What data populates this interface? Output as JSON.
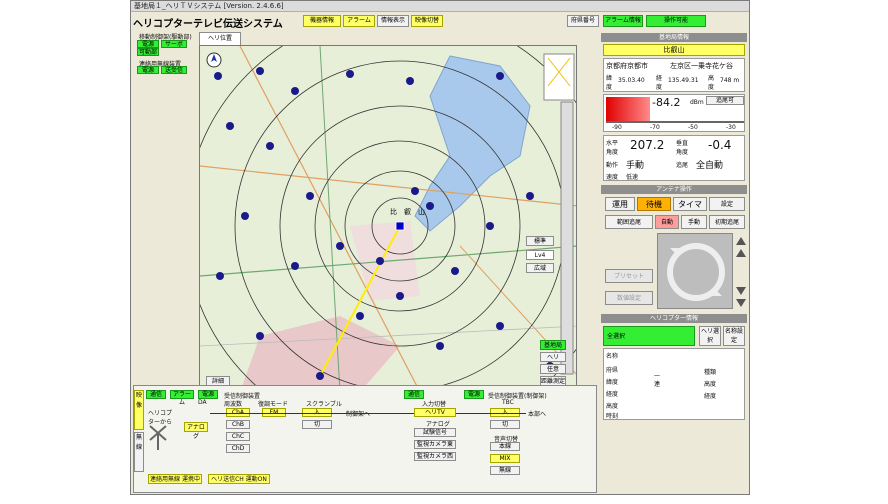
{
  "window": {
    "title": "基地局１_ヘリＴＶシステム [Version. 2.4.6.6]",
    "app_title": "ヘリコプターテレビ伝送システム"
  },
  "toolbar": {
    "equipment_info": "機器情報",
    "alarm": "アラーム",
    "info_display": "情報表示",
    "video_switch": "映像切替",
    "station_number": "府県番号",
    "alarm_info": "アラーム情報",
    "operation_enabled": "操作可能"
  },
  "left_panel": {
    "drive_control_label": "移動制御架(駆動部)",
    "power": "電源",
    "servo": "サーボ",
    "fixed_unit": "可動部",
    "comm_device_label": "連絡用無線装置",
    "power2": "電源",
    "tx_rx": "送受信"
  },
  "map": {
    "tab": "ヘリ位置",
    "label_hiei": "比　叡　山",
    "buttons": {
      "standard": "標準",
      "level": "Lv4",
      "wide": "広域",
      "base_station": "基地局",
      "heli": "ヘリ",
      "arbitrary": "任意",
      "distance": "距離測定",
      "detail": "詳細"
    }
  },
  "station_info": {
    "header": "基地局情報",
    "name": "比叡山",
    "address_pref": "京都府京都市",
    "address_ward": "左京区一乗寺花ケ谷",
    "lat_label": "緯度",
    "lat": "35.03.40",
    "lon_label": "経度",
    "lon": "135.49.31",
    "alt_label": "高度",
    "alt": "748 m",
    "signal": "-84.2",
    "signal_unit": "dBm",
    "tracking": "追尾可",
    "scale": [
      "-90",
      "-70",
      "-50",
      "-30"
    ],
    "signal_level": 0.18,
    "h_label": "水平角度",
    "h_value": "207.2",
    "v_label": "垂直角度",
    "v_value": "-0.4",
    "motion_label": "動作",
    "motion_value": "手動",
    "track_label": "追尾",
    "track_value": "全自動",
    "speed_label": "速度",
    "speed_value": "低速"
  },
  "antenna": {
    "header": "アンテナ操作",
    "operate": "運用",
    "standby": "待機",
    "timer": "タイマ",
    "setting": "設定",
    "range_track": "範囲追尾",
    "auto": "自動",
    "manual": "手動",
    "initial_track": "初期追尾",
    "preset": "プリセット",
    "value_setting": "数値設定"
  },
  "heli_info": {
    "header": "ヘリコプター情報",
    "select_all": "全選択",
    "heli_select": "ヘリ選択",
    "name_select": "名称設定",
    "rows_left": [
      "名称",
      "府県",
      "緯度",
      "経度",
      "高度",
      "時刻"
    ],
    "col_mid": [
      "一",
      "連"
    ],
    "rows_right": [
      "種類",
      "高度",
      "経度"
    ]
  },
  "bottom": {
    "side_video": "映像",
    "side_wireless": "無線",
    "comm": "通信",
    "alarm": "アラーム",
    "power": "電源",
    "receiver": "受信制御装置",
    "da": "DA",
    "freq": "周波数",
    "demod_mode": "復調モード",
    "scramble": "スクランブル",
    "heli_from": "ヘリコプターから",
    "analog": "アナログ",
    "cha": "ChA",
    "chb": "ChB",
    "chc": "ChC",
    "chd": "ChD",
    "fm": "FM",
    "in": "入",
    "off": "切",
    "to_ctrl": "制御架へ",
    "comm2": "通信",
    "power2": "電源",
    "receiver2": "受信制御装置(制御架)",
    "input_switch": "入力切替",
    "hd_tv": "ヘリTV",
    "analog2": "アナログ",
    "test_signal": "試験信号",
    "mon_east": "監視カメラ東",
    "mon_west": "監視カメラ西",
    "tbc": "TBC",
    "in2": "入",
    "off2": "切",
    "to_hq": "本部へ",
    "audio_switch": "音声切替",
    "audio_main": "本線",
    "mix": "MIX",
    "wireless": "無線",
    "status1": "連絡用無線 運携中",
    "status2": "ヘリ送信CH 運動ON"
  },
  "colors": {
    "accent_green": "#33ee33",
    "accent_yellow": "#ffff66",
    "accent_orange": "#ffb000"
  }
}
